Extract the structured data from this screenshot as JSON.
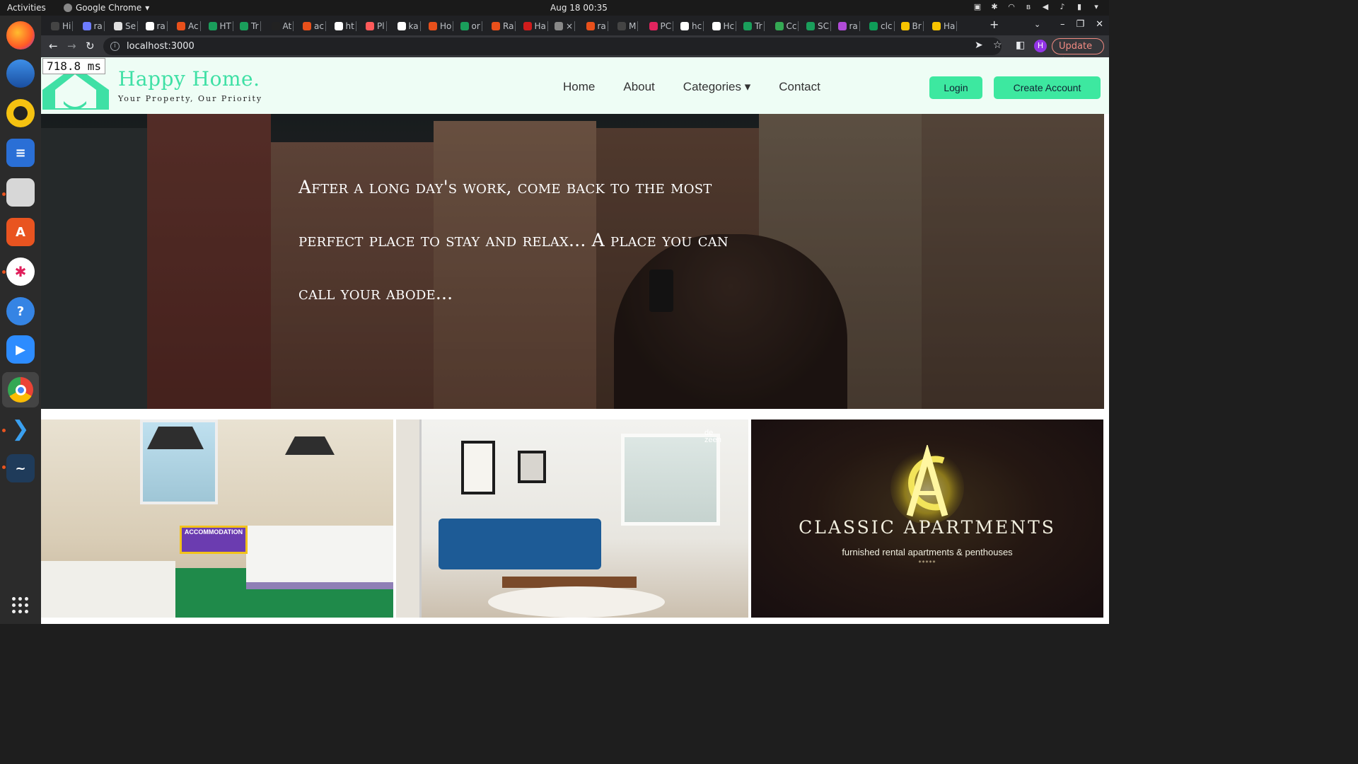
{
  "system": {
    "activities": "Activities",
    "app_name": "Google Chrome",
    "clock": "Aug 18  00:35"
  },
  "dock": {
    "apps": [
      "firefox-icon",
      "thunderbird-icon",
      "rhythmbox-icon",
      "writer-icon",
      "files-icon",
      "software-icon",
      "slack-icon",
      "help-icon",
      "zoom-icon",
      "chrome-icon",
      "vscode-icon",
      "mysql-workbench-icon"
    ]
  },
  "browser": {
    "tabs": [
      "Hi",
      "ra",
      "Se",
      "ra",
      "Ac",
      "HT",
      "Tr",
      "At",
      "ac",
      "ht",
      "Pl",
      "ka",
      "Ho",
      "or",
      "Ra",
      "Ha",
      "×",
      "ra",
      "M",
      "PC",
      "hc",
      "Hc",
      "Tr",
      "Cc",
      "SC",
      "ra",
      "clc",
      "Br",
      "Ha"
    ],
    "url": "localhost:3000",
    "profile_initial": "H",
    "update_label": "Update"
  },
  "page": {
    "timer": "718.8 ms",
    "brand": "Happy Home.",
    "tagline": "Your Property, Our Priority",
    "nav": {
      "home": "Home",
      "about": "About",
      "categories": "Categories ▾",
      "contact": "Contact"
    },
    "login_label": "Login",
    "create_account_label": "Create Account",
    "hero_text": "After a long day's work, come back to the most perfect place to stay and relax... A place you can call your abode...",
    "cards": {
      "card1_sign": "ACCOMMODATION",
      "card2_watermark": "de zeen",
      "card3_title": "CLASSIC APARTMENTS",
      "card3_subtitle": "furnished rental apartments & penthouses",
      "card3_stars": "*****"
    }
  },
  "colors": {
    "accent_green": "#3de8a0",
    "brand_green": "#3fe0a5",
    "header_bg": "#eefdf5"
  }
}
